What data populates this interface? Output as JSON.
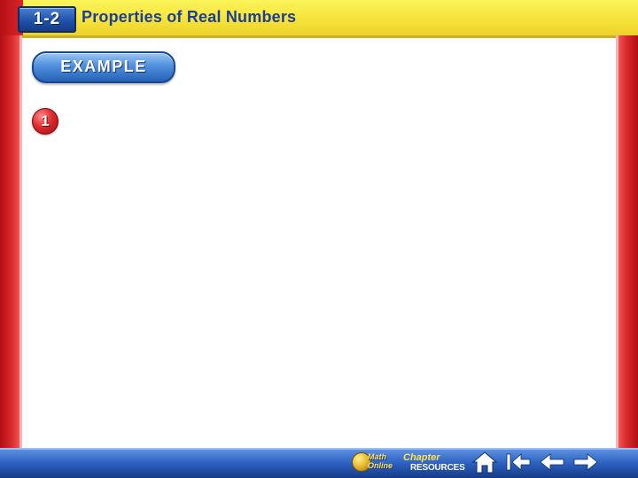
{
  "header": {
    "lesson_number": "1-2",
    "lesson_title": "Properties of Real Numbers"
  },
  "example": {
    "label": "EXAMPLE",
    "number": "1"
  },
  "footer": {
    "math_online_label": "Math Online",
    "chapter_label": "Chapter",
    "resources_label": "RESOURCES",
    "nav": {
      "home_icon": "home-icon",
      "first_icon": "first-slide-icon",
      "prev_icon": "arrow-left-icon",
      "next_icon": "arrow-right-icon"
    }
  },
  "colors": {
    "header_yellow": "#f6e33a",
    "frame_red": "#d8262a",
    "accent_blue": "#2662b7",
    "title_blue": "#1b3f96"
  }
}
